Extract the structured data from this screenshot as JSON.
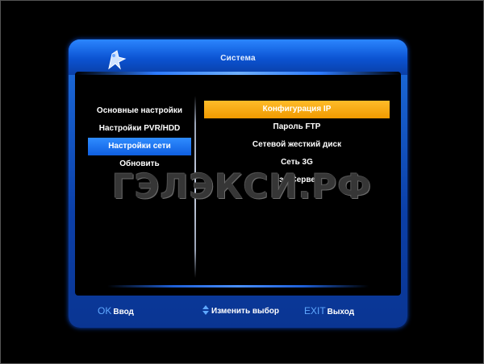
{
  "header": {
    "title": "Система"
  },
  "left_menu": {
    "items": [
      {
        "label": "Основные настройки",
        "active": false
      },
      {
        "label": "Настройки PVR/HDD",
        "active": false
      },
      {
        "label": "Настройки сети",
        "active": true
      },
      {
        "label": "Обновить",
        "active": false
      }
    ]
  },
  "right_menu": {
    "items": [
      {
        "label": "Конфигурация IP",
        "active": true
      },
      {
        "label": "Пароль FTP",
        "active": false
      },
      {
        "label": "Сетевой жесткий диск",
        "active": false
      },
      {
        "label": "Сеть 3G",
        "active": false
      },
      {
        "label": "Вэб Сервер",
        "active": false
      }
    ]
  },
  "footer": {
    "ok_key": "OK",
    "ok_label": "Ввод",
    "change_label": "Изменить выбор",
    "exit_key": "EXIT",
    "exit_label": "Выход"
  },
  "watermark": "ГЭЛЭКСИ.РФ",
  "colors": {
    "accent_blue": "#1a6cff",
    "highlight_orange": "#f5a400",
    "background": "#000000"
  }
}
